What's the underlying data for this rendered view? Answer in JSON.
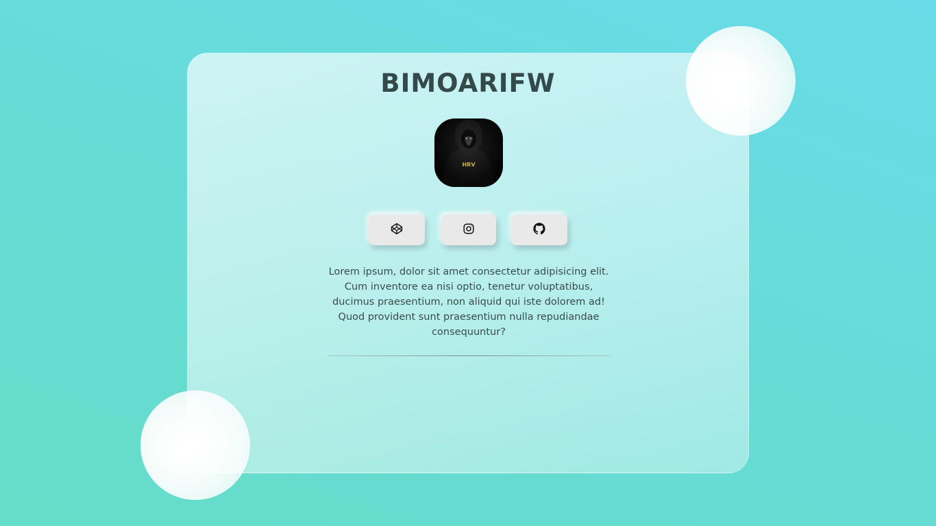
{
  "profile": {
    "name": "BIMOARIFW",
    "avatar_alt": "HRV",
    "description": "Lorem ipsum, dolor sit amet consectetur adipisicing elit. Cum inventore ea nisi optio, tenetur voluptatibus, ducimus praesentium, non aliquid qui iste dolorem ad! Quod provident sunt praesentium nulla repudiandae consequuntur?"
  },
  "social": {
    "icons": [
      "codepen-icon",
      "instagram-icon",
      "github-icon"
    ]
  },
  "colors": {
    "background_top": "#68dbe8",
    "background_bottom": "#66ddc8",
    "title": "#33494a",
    "text": "#3a4b4c",
    "button": "#e9e9e9"
  }
}
